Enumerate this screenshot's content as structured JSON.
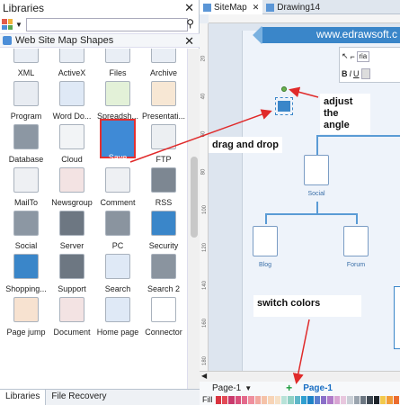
{
  "libraries": {
    "title": "Libraries",
    "category": "Web Site Map Shapes",
    "shapes": [
      {
        "label": "XML",
        "icon": "xml-icon",
        "color": "#e9eef5"
      },
      {
        "label": "ActiveX",
        "icon": "activex-icon",
        "color": "#e9eef5"
      },
      {
        "label": "Files",
        "icon": "files-icon",
        "color": "#e9eef5"
      },
      {
        "label": "Archive",
        "icon": "archive-icon",
        "color": "#e9eef5"
      },
      {
        "label": "Program",
        "icon": "program-icon",
        "color": "#e8ecf2"
      },
      {
        "label": "Word Do...",
        "icon": "word-doc-icon",
        "color": "#dfe9f6"
      },
      {
        "label": "Spreadsh...",
        "icon": "spreadsheet-icon",
        "color": "#e3f1d8"
      },
      {
        "label": "Presentati...",
        "icon": "presentation-icon",
        "color": "#f7e7d4"
      },
      {
        "label": "Database",
        "icon": "database-icon",
        "color": "#8c97a3"
      },
      {
        "label": "Cloud",
        "icon": "cloud-icon",
        "color": "#f2f4f6"
      },
      {
        "label": "Save",
        "icon": "save-icon",
        "color": "#3f8ad6"
      },
      {
        "label": "FTP",
        "icon": "ftp-icon",
        "color": "#eceff2"
      },
      {
        "label": "MailTo",
        "icon": "mailto-icon",
        "color": "#eef0f3"
      },
      {
        "label": "Newsgroup",
        "icon": "newsgroup-icon",
        "color": "#f3e3e3"
      },
      {
        "label": "Comment",
        "icon": "comment-icon",
        "color": "#eef0f3"
      },
      {
        "label": "RSS",
        "icon": "rss-icon",
        "color": "#7d8792"
      },
      {
        "label": "Social",
        "icon": "social-icon",
        "color": "#8c97a3"
      },
      {
        "label": "Server",
        "icon": "server-icon",
        "color": "#6d7782"
      },
      {
        "label": "PC",
        "icon": "pc-icon",
        "color": "#8a949f"
      },
      {
        "label": "Security",
        "icon": "security-icon",
        "color": "#3a86c9"
      },
      {
        "label": "Shopping...",
        "icon": "shopping-icon",
        "color": "#3a86c9"
      },
      {
        "label": "Support",
        "icon": "support-icon",
        "color": "#6d7782"
      },
      {
        "label": "Search",
        "icon": "search-icon",
        "color": "#dfe9f6"
      },
      {
        "label": "Search 2",
        "icon": "search2-icon",
        "color": "#8a949f"
      },
      {
        "label": "Page jump",
        "icon": "page-jump-icon",
        "color": "#f7e2d0"
      },
      {
        "label": "Document",
        "icon": "document-icon",
        "color": "#f3e3e3"
      },
      {
        "label": "Home page",
        "icon": "home-page-icon",
        "color": "#dfe9f6"
      },
      {
        "label": "Connector",
        "icon": "connector-icon",
        "color": "#ffffff"
      }
    ],
    "bottom_tabs": [
      "Libraries",
      "File Recovery"
    ]
  },
  "doc_tabs": [
    {
      "label": "SiteMap",
      "active": true
    },
    {
      "label": "Drawing14",
      "active": false
    }
  ],
  "canvas": {
    "banner": "www.edrawsoft.c",
    "font_box": "ria",
    "fmt_buttons": [
      "B",
      "I",
      "U"
    ],
    "nodes": [
      {
        "label": "Social"
      },
      {
        "label": "Blog"
      },
      {
        "label": "Forum"
      }
    ],
    "ruler_marks": [
      "20",
      "40",
      "60",
      "80",
      "100",
      "120",
      "140",
      "160",
      "180"
    ]
  },
  "callouts": {
    "adjust": "adjust the angle",
    "drag": "drag and drop",
    "switch": "switch colors"
  },
  "pagebar": {
    "page_select": "Page-1",
    "active_page": "Page-1",
    "fill_label": "Fill"
  },
  "fill_colors": [
    "#d9333f",
    "#e24b56",
    "#c93a6d",
    "#d94f7a",
    "#e36a8b",
    "#ef8f9e",
    "#f2a9a0",
    "#f5c2a8",
    "#f7d4b6",
    "#f6e0c6",
    "#b8e2d8",
    "#8fd0c4",
    "#5fb7c8",
    "#2f9fd0",
    "#1e82c6",
    "#5a7fcf",
    "#8a6fc9",
    "#b17bc8",
    "#d9a5d3",
    "#e8c7de",
    "#c9cfd6",
    "#9aa4ae",
    "#6c7782",
    "#3e4852",
    "#1d2329",
    "#f2c94c",
    "#f29c38",
    "#eb6c2f"
  ],
  "accent": "#3a86c9"
}
